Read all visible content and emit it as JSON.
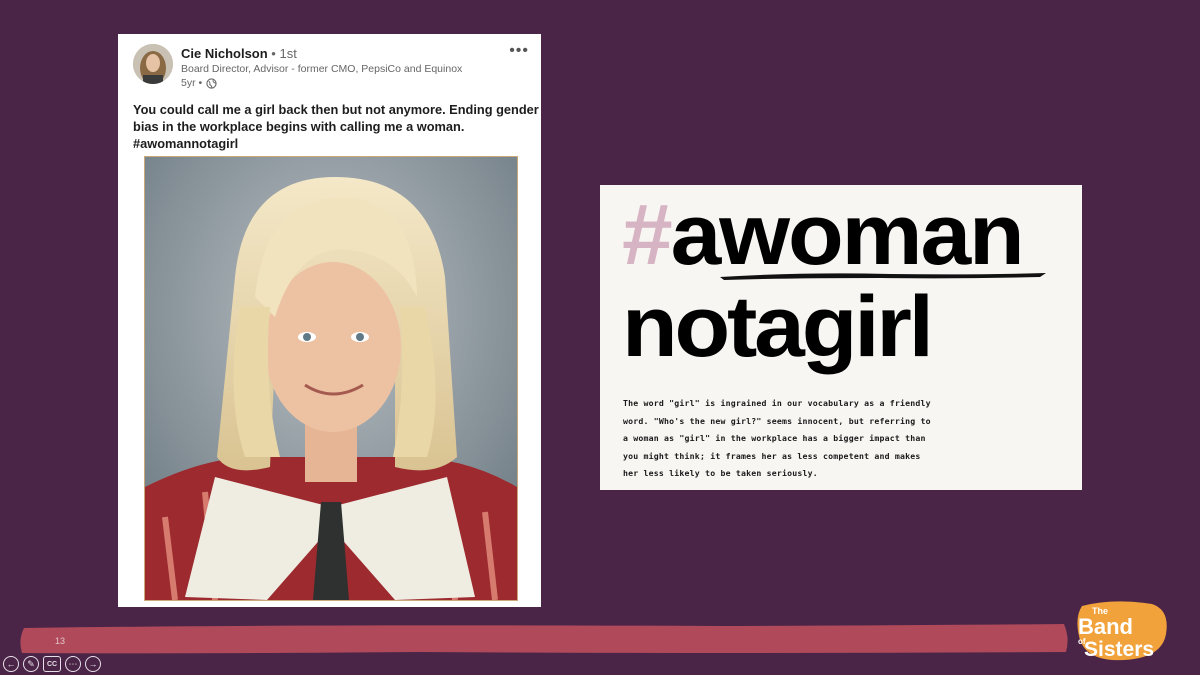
{
  "post": {
    "author_name": "Cie Nicholson",
    "connection": " • 1st",
    "headline": "Board Director, Advisor - former CMO, PepsiCo and Equinox",
    "timestamp": "5yr •",
    "more_label": "•••",
    "text_lines": [
      "You could call me a girl back then but not anymore. Ending gender",
      "bias in the workplace begins with calling me a woman.",
      "#awomannotagirl"
    ]
  },
  "graphic": {
    "hash": "#",
    "line1": "awoman",
    "line2": "notagirl",
    "body_lines": [
      "The word \"girl\" is ingrained in our vocabulary as a friendly",
      "word. \"Who's the new girl?\" seems innocent,  but referring to",
      "a woman as \"girl\" in the workplace has a bigger impact than",
      "you might think; it frames her as less competent and makes",
      "her less likely to be taken seriously."
    ]
  },
  "slide": {
    "number": "13",
    "cc_label": "CC"
  },
  "logo": {
    "the": "The",
    "band": "Band",
    "of": "of",
    "sisters": "Sisters"
  },
  "colors": {
    "background": "#4a2548",
    "bar": "#b04a5a",
    "hash_pink": "#d7b4c3",
    "logo_orange": "#f2a23a"
  }
}
